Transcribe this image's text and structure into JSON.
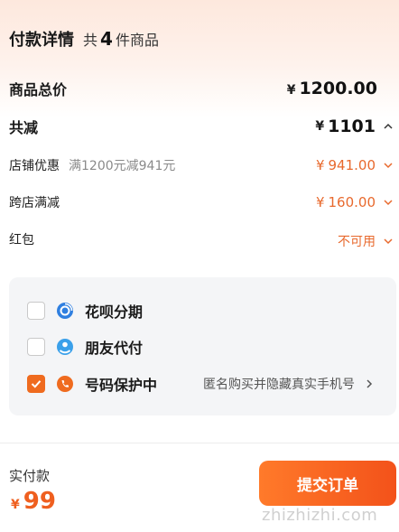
{
  "header": {
    "title": "付款详情",
    "count_prefix": "共",
    "count": "4",
    "count_suffix": "件商品"
  },
  "summary": {
    "total_label": "商品总价",
    "total_currency": "¥",
    "total_value": "1200.00",
    "discount_label": "共减",
    "discount_currency": "¥",
    "discount_value": "1101"
  },
  "discounts": [
    {
      "label": "店铺优惠",
      "note": "满1200元减941元",
      "currency": "¥",
      "value": "941.00"
    },
    {
      "label": "跨店满减",
      "note": "",
      "currency": "¥",
      "value": "160.00"
    },
    {
      "label": "红包",
      "note": "",
      "currency": "",
      "value": "不可用"
    }
  ],
  "payment_options": [
    {
      "label": "花呗分期",
      "checked": false,
      "icon": "huabei-icon"
    },
    {
      "label": "朋友代付",
      "checked": false,
      "icon": "friend-pay-icon"
    },
    {
      "label": "号码保护中",
      "checked": true,
      "icon": "phone-protect-icon",
      "hint": "匿名购买并隐藏真实手机号"
    }
  ],
  "footer": {
    "paid_label": "实付款",
    "paid_currency": "¥",
    "paid_value": "99",
    "submit_label": "提交订单",
    "watermark": "zhizhizhi.com"
  },
  "colors": {
    "accent": "#ef6b1f",
    "icon_blue": "#2f7fe0",
    "icon_sky": "#3aa0ea"
  }
}
